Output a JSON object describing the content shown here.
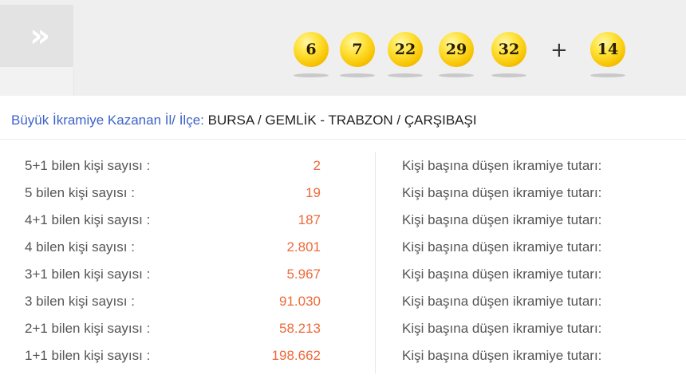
{
  "header": {
    "expand_icon": "double-chevron-right-icon",
    "expand_glyph": "»",
    "main_numbers": [
      "6",
      "7",
      "22",
      "29",
      "32"
    ],
    "plus": "+",
    "bonus_number": "14",
    "ball_color": "#f7c300"
  },
  "winner": {
    "label": "Büyük İkramiye Kazanan İl/ İlçe:",
    "value": "BURSA / GEMLİK - TRABZON / ÇARŞIBAŞI"
  },
  "results": [
    {
      "label": "5+1 bilen kişi sayısı :",
      "count": "2",
      "prize_label": "Kişi başına düşen ikramiye tutarı:"
    },
    {
      "label": "5 bilen kişi sayısı :",
      "count": "19",
      "prize_label": "Kişi başına düşen ikramiye tutarı:"
    },
    {
      "label": "4+1 bilen kişi sayısı :",
      "count": "187",
      "prize_label": "Kişi başına düşen ikramiye tutarı:"
    },
    {
      "label": "4 bilen kişi sayısı :",
      "count": "2.801",
      "prize_label": "Kişi başına düşen ikramiye tutarı:"
    },
    {
      "label": "3+1 bilen kişi sayısı :",
      "count": "5.967",
      "prize_label": "Kişi başına düşen ikramiye tutarı:"
    },
    {
      "label": "3 bilen kişi sayısı :",
      "count": "91.030",
      "prize_label": "Kişi başına düşen ikramiye tutarı:"
    },
    {
      "label": "2+1 bilen kişi sayısı :",
      "count": "58.213",
      "prize_label": "Kişi başına düşen ikramiye tutarı:"
    },
    {
      "label": "1+1 bilen kişi sayısı :",
      "count": "198.662",
      "prize_label": "Kişi başına düşen ikramiye tutarı:"
    }
  ],
  "colors": {
    "accent_blue": "#3d63c9",
    "count_orange": "#ee6a3a"
  }
}
